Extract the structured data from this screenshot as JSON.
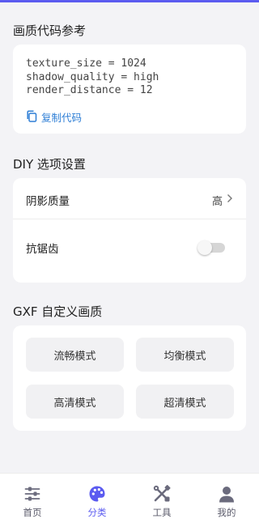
{
  "colors": {
    "accent": "#5b5bf0",
    "link": "#2f7fd6"
  },
  "code_section": {
    "title": "画质代码参考",
    "lines": [
      "texture_size = 1024",
      "shadow_quality = high",
      "render_distance = 12"
    ],
    "copy_label": "复制代码",
    "copy_icon": "copy-icon"
  },
  "diy_section": {
    "title": "DIY 选项设置",
    "shadow_quality": {
      "label": "阴影质量",
      "value": "高"
    },
    "anti_aliasing": {
      "label": "抗锯齿",
      "enabled": false
    }
  },
  "gxf_section": {
    "title": "GXF 自定义画质",
    "modes": [
      "流畅模式",
      "均衡模式",
      "高清模式",
      "超清模式"
    ]
  },
  "bottom_nav": {
    "active_index": 1,
    "items": [
      {
        "label": "首页",
        "icon": "sliders-icon"
      },
      {
        "label": "分类",
        "icon": "palette-icon"
      },
      {
        "label": "工具",
        "icon": "tools-icon"
      },
      {
        "label": "我的",
        "icon": "user-icon"
      }
    ]
  }
}
